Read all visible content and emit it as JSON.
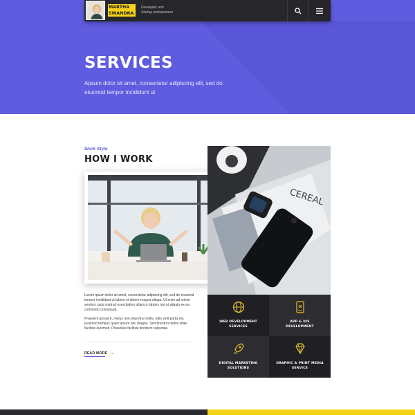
{
  "header": {
    "logo_name_line1": "MARTHA",
    "logo_name_line2": "SWANDRA",
    "logo_sub_line1": "Developer and",
    "logo_sub_line2": "Startup entrepreneur",
    "search_icon": "search-icon",
    "menu_icon": "hamburger-menu-icon"
  },
  "hero": {
    "title": "SERVICES",
    "text": "Apsum dolor sit amet, consectetur adipiscing elit, sed do eiusmod tempor incididunt ut"
  },
  "work": {
    "eyebrow": "Work Style",
    "title": "HOW I WORK",
    "paragraph1": "Lorem ipsum dolor sit amet, consectetur adipiscing elit, sed do eiusmod tempor incididunt ut labore et dolore magna aliqua. Ut enim ad minim veniam, quis nostrud exercitation ullamco laboris nisi ut aliquip ex ea commodo consequat.",
    "paragraph2": "Praesent posuere, metus non pharetra mollis, odio velit porta est, euismod tempus quam ipsum nec magna. Sed tincidunt tellus vitae facilisis euismod. Phasellus facilisis tincidunt vulputate.",
    "read_more": "READ MORE",
    "read_more_arrow": "→"
  },
  "services": [
    {
      "label": "WEB DEVELOPMENT\nSERVICES",
      "icon": "globe-code-icon"
    },
    {
      "label": "APP & IOS\nDEVELOPMENT",
      "icon": "mobile-app-icon"
    },
    {
      "label": "DIGITAL MARKETING\nSOLUTIONS",
      "icon": "rocket-icon"
    },
    {
      "label": "GRAPHIC & PRINT MEDIA\nSERVICE",
      "icon": "diamond-icon"
    }
  ],
  "colors": {
    "accent": "#5f5ce0",
    "highlight": "#f5d21b",
    "dark": "#27272b",
    "icon_gold": "#e6c325"
  }
}
